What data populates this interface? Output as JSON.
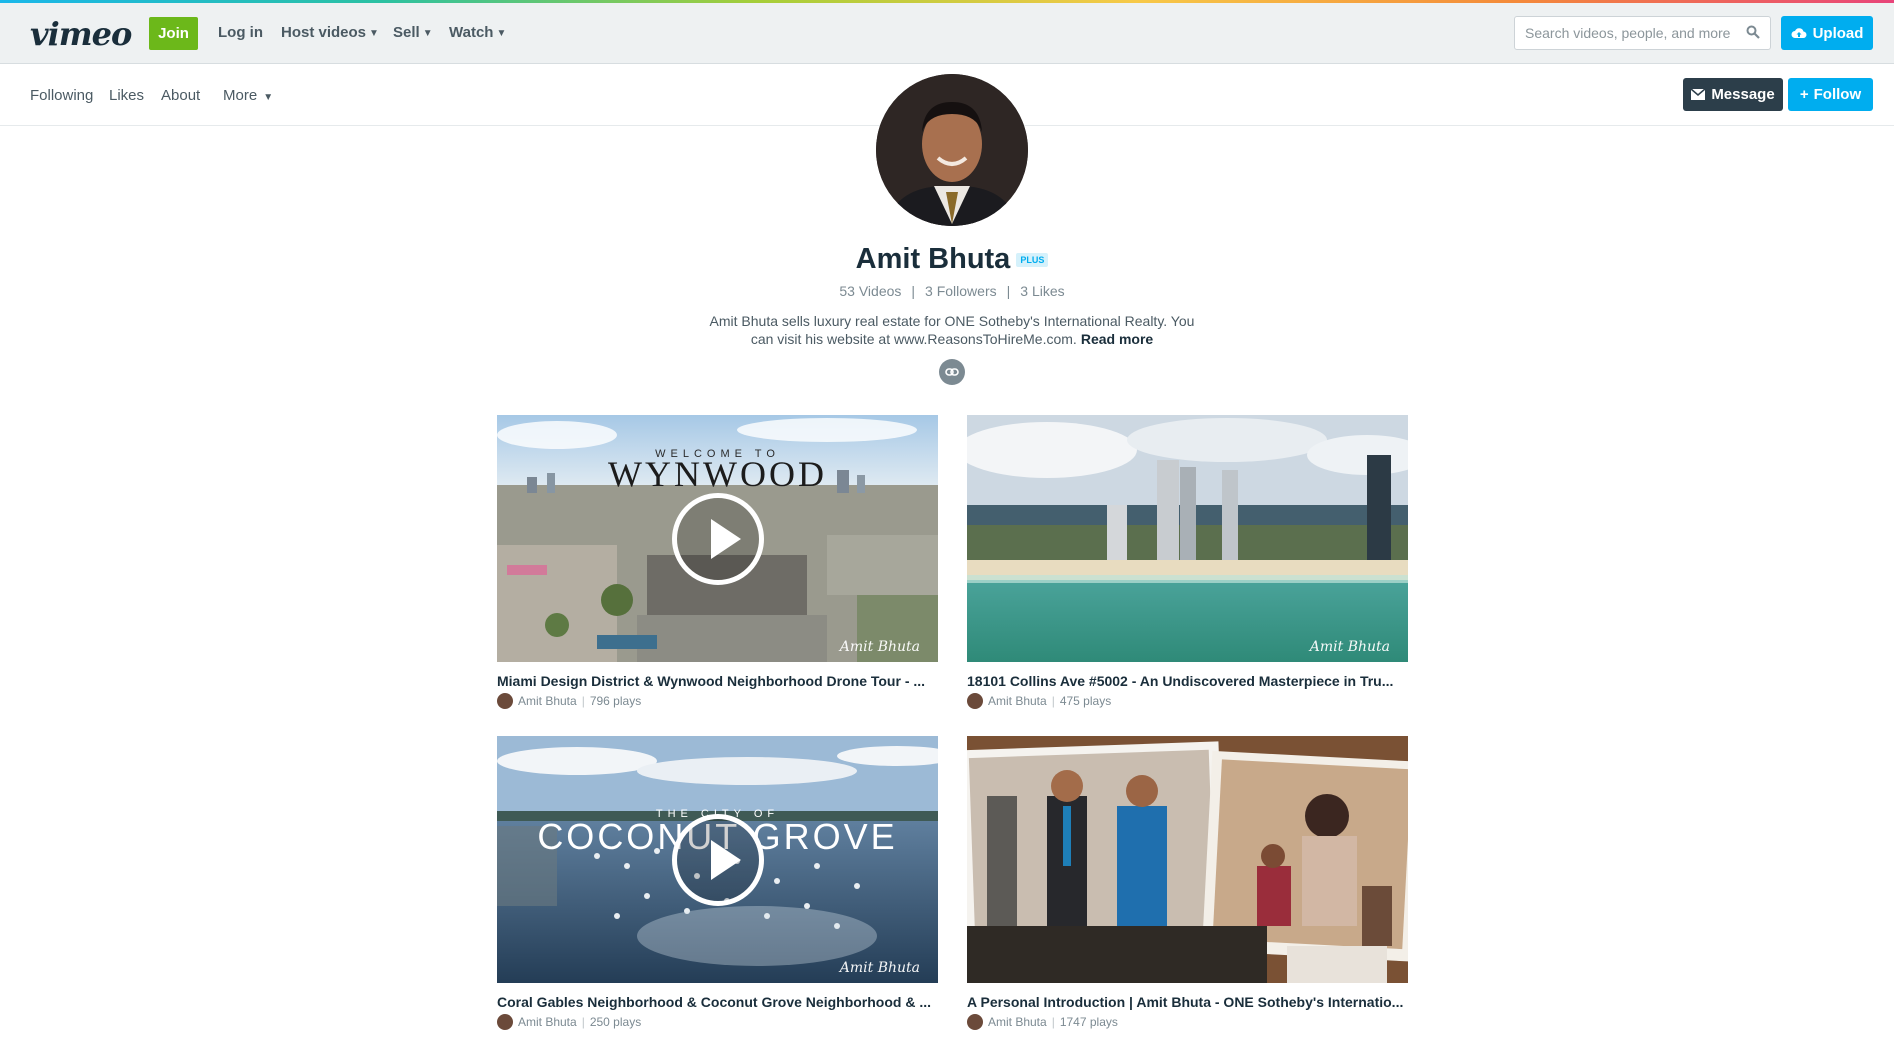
{
  "topnav": {
    "logo": "vimeo",
    "join": "Join",
    "login": "Log in",
    "host_videos": "Host videos",
    "sell": "Sell",
    "watch": "Watch",
    "search_placeholder": "Search videos, people, and more",
    "upload": "Upload"
  },
  "subnav": {
    "following": "Following",
    "likes": "Likes",
    "about": "About",
    "more": "More",
    "message": "Message",
    "follow": "Follow"
  },
  "profile": {
    "name": "Amit Bhuta",
    "badge": "PLUS",
    "videos": "53 Videos",
    "followers": "3 Followers",
    "likes": "3 Likes",
    "bio": "Amit Bhuta sells luxury real estate for ONE Sotheby's International Realty. You can visit his website at www.ReasonsToHireMe.com.",
    "read_more": "Read more"
  },
  "videos": [
    {
      "title": "Miami Design District & Wynwood Neighborhood Drone Tour - ...",
      "author": "Amit Bhuta",
      "plays": "796 plays",
      "overlay_small": "WELCOME TO",
      "overlay_big": "WYNWOOD",
      "signature": "Amit Bhuta"
    },
    {
      "title": "18101 Collins Ave #5002 - An Undiscovered Masterpiece in Tru...",
      "author": "Amit Bhuta",
      "plays": "475 plays",
      "signature": "Amit Bhuta"
    },
    {
      "title": "Coral Gables Neighborhood & Coconut Grove Neighborhood & ...",
      "author": "Amit Bhuta",
      "plays": "250 plays",
      "overlay_small": "THE CITY OF",
      "overlay_big": "COCONUT GROVE",
      "signature": "Amit Bhuta"
    },
    {
      "title": "A Personal Introduction | Amit Bhuta - ONE Sotheby's Internatio...",
      "author": "Amit Bhuta",
      "plays": "1747 plays"
    }
  ]
}
